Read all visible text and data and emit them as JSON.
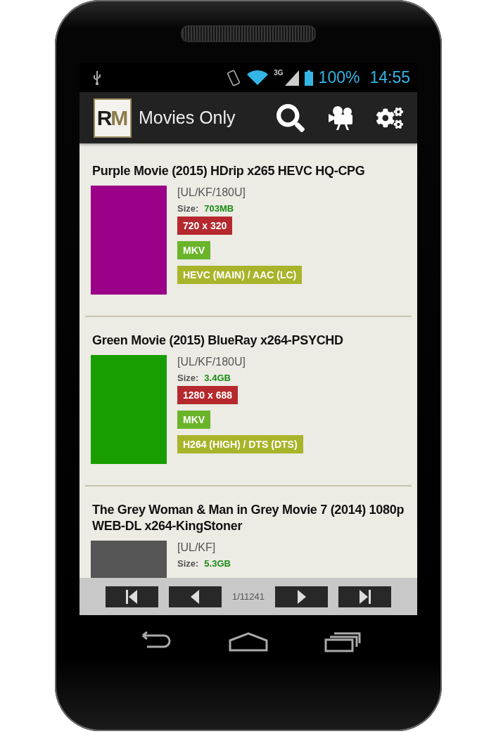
{
  "status_bar": {
    "network": "3G",
    "battery": "100%",
    "time": "14:55"
  },
  "action_bar": {
    "logo": "RM",
    "title": "Movies Only"
  },
  "movies": [
    {
      "title": "Purple Movie (2015) HDrip x265 HEVC HQ-CPG",
      "color": "#9a0088",
      "flags": "[UL/KF/180U]",
      "size_label": "Size:",
      "size": "703MB",
      "tags": [
        {
          "kind": "resolution",
          "text": "720 x 320"
        },
        {
          "kind": "container",
          "text": "MKV"
        },
        {
          "kind": "codec",
          "text": "HEVC (MAIN) / AAC (LC)"
        }
      ]
    },
    {
      "title": "Green Movie (2015) BlueRay x264-PSYCHD",
      "color": "#189e00",
      "flags": "[UL/KF/180U]",
      "size_label": "Size:",
      "size": "3.4GB",
      "tags": [
        {
          "kind": "resolution",
          "text": "1280 x 688"
        },
        {
          "kind": "container",
          "text": "MKV"
        },
        {
          "kind": "codec",
          "text": "H264 (HIGH) / DTS (DTS)"
        }
      ]
    },
    {
      "title": "The Grey Woman & Man in Grey Movie  7 (2014) 1080p WEB-DL x264-KingStoner",
      "color": "#555555",
      "flags": "[UL/KF]",
      "size_label": "Size:",
      "size": "5.3GB"
    }
  ],
  "pager": {
    "page": "1/11241"
  }
}
